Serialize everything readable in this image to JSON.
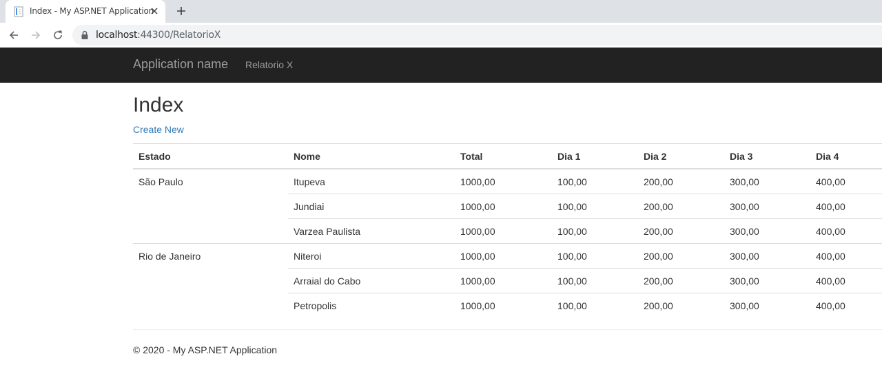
{
  "browser": {
    "tab_title": "Index - My ASP.NET Application",
    "url_host": "localhost",
    "url_path": ":44300/RelatorioX"
  },
  "navbar": {
    "brand": "Application name",
    "links": [
      "Relatorio X"
    ]
  },
  "page": {
    "title": "Index",
    "create_link": "Create New"
  },
  "table": {
    "headers": [
      "Estado",
      "Nome",
      "Total",
      "Dia 1",
      "Dia 2",
      "Dia 3",
      "Dia 4"
    ],
    "groups": [
      {
        "estado": "São Paulo",
        "rows": [
          {
            "nome": "Itupeva",
            "total": "1000,00",
            "d1": "100,00",
            "d2": "200,00",
            "d3": "300,00",
            "d4": "400,00"
          },
          {
            "nome": "Jundiai",
            "total": "1000,00",
            "d1": "100,00",
            "d2": "200,00",
            "d3": "300,00",
            "d4": "400,00"
          },
          {
            "nome": "Varzea Paulista",
            "total": "1000,00",
            "d1": "100,00",
            "d2": "200,00",
            "d3": "300,00",
            "d4": "400,00"
          }
        ]
      },
      {
        "estado": "Rio de Janeiro",
        "rows": [
          {
            "nome": "Niteroi",
            "total": "1000,00",
            "d1": "100,00",
            "d2": "200,00",
            "d3": "300,00",
            "d4": "400,00"
          },
          {
            "nome": "Arraial do Cabo",
            "total": "1000,00",
            "d1": "100,00",
            "d2": "200,00",
            "d3": "300,00",
            "d4": "400,00"
          },
          {
            "nome": "Petropolis",
            "total": "1000,00",
            "d1": "100,00",
            "d2": "200,00",
            "d3": "300,00",
            "d4": "400,00"
          }
        ]
      }
    ]
  },
  "footer": {
    "text": "© 2020 - My ASP.NET Application"
  },
  "icons": {
    "favicon": "page-icon",
    "tab_close": "close-icon",
    "new_tab": "plus-icon",
    "back": "arrow-left-icon",
    "forward": "arrow-right-icon",
    "reload": "reload-icon",
    "lock": "lock-icon"
  },
  "colors": {
    "navbar_bg": "#222222",
    "navbar_text": "#9d9d9d",
    "link": "#337ab7",
    "tabstrip_bg": "#dee1e6",
    "omnibox_bg": "#f1f3f4"
  }
}
